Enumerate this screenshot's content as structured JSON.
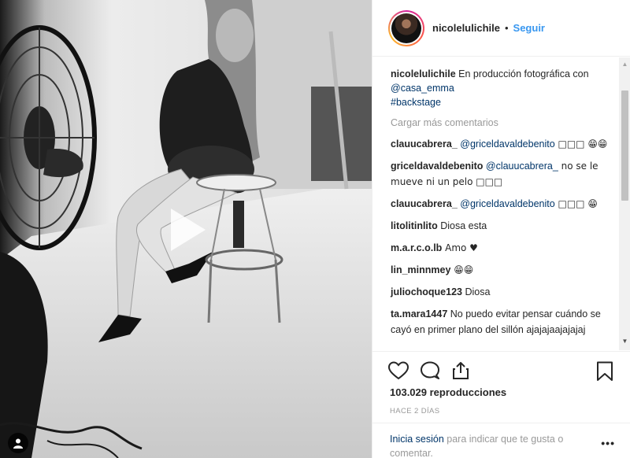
{
  "post": {
    "author": "nicolelulichile",
    "follow_label": "Seguir",
    "separator": "•"
  },
  "caption": {
    "username": "nicolelulichile",
    "text_before": "En producción fotográfica con ",
    "mention": "@casa_emma",
    "hashtag": "#backstage"
  },
  "load_more_label": "Cargar más comentarios",
  "comments": [
    {
      "username": "clauucabrera_",
      "mention": "@griceldavaldebenito",
      "text": " □□□ 😁😁"
    },
    {
      "username": "griceldavaldebenito",
      "mention": "@clauucabrera_",
      "text": " no se le mueve ni un pelo □□□"
    },
    {
      "username": "clauucabrera_",
      "mention": "@griceldavaldebenito",
      "text": " □□□ 😁"
    },
    {
      "username": "litolitinlito",
      "mention": "",
      "text": " Diosa esta"
    },
    {
      "username": "m.a.r.c.o.lb",
      "mention": "",
      "text": " Amo ♥"
    },
    {
      "username": "lin_minnmey",
      "mention": "",
      "text": " 😁😁"
    },
    {
      "username": "juliochoque123",
      "mention": "",
      "text": " Diosa"
    },
    {
      "username": "ta.mara1447",
      "mention": "",
      "text": " No puedo evitar pensar cuándo se cayó en primer plano del sillón ajajajaajajajaj"
    }
  ],
  "views": "103.029 reproducciones",
  "timestamp": "HACE 2 DÍAS",
  "login": {
    "link": "Inicia sesión",
    "text": " para indicar que te gusta o comentar."
  },
  "more_options": "•••",
  "icons": {
    "like": "heart-icon",
    "comment": "comment-icon",
    "share": "share-icon",
    "save": "bookmark-icon",
    "play": "play-icon",
    "user": "user-icon"
  },
  "colors": {
    "link_blue": "#3897f0",
    "mention_blue": "#003569",
    "muted": "#999999"
  }
}
